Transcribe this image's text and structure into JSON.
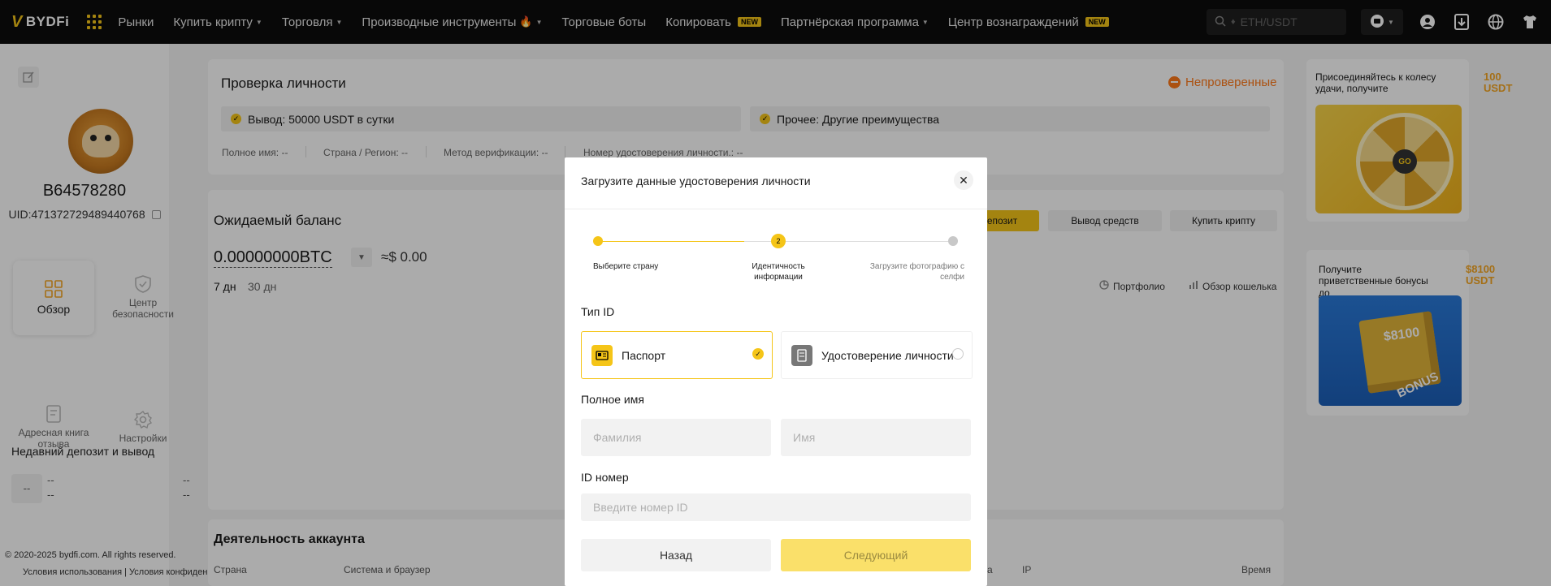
{
  "topnav": {
    "logo": "BYDFi",
    "items": [
      {
        "label": "Рынки",
        "caret": false,
        "badge": "",
        "fire": false
      },
      {
        "label": "Купить крипту",
        "caret": true,
        "badge": "",
        "fire": false
      },
      {
        "label": "Торговля",
        "caret": true,
        "badge": "",
        "fire": false
      },
      {
        "label": "Производные инструменты",
        "caret": true,
        "badge": "",
        "fire": true
      },
      {
        "label": "Торговые боты",
        "caret": false,
        "badge": "",
        "fire": false
      },
      {
        "label": "Копировать",
        "caret": false,
        "badge": "NEW",
        "fire": false
      },
      {
        "label": "Партнёрская программа",
        "caret": true,
        "badge": "",
        "fire": false
      },
      {
        "label": "Центр вознаграждений",
        "caret": false,
        "badge": "NEW",
        "fire": false
      }
    ],
    "search_placeholder": "ETH/USDT",
    "accent": "#f5c518"
  },
  "sidebar": {
    "username": "B64578280",
    "uid": "UID:471372729489440768",
    "tiles": {
      "overview": "Обзор",
      "security": "Центр безопасности",
      "address_book": "Адресная книга отзыва",
      "settings": "Настройки"
    },
    "recent_title": "Недавний депозит и вывод",
    "recent_dash": "--",
    "copyright": "© 2020-2025 bydfi.com. All rights reserved.",
    "footer_links": "Условия использования |  Условия конфиденциальности"
  },
  "kyc": {
    "title": "Проверка личности",
    "status": "Непроверенные",
    "perk1": "Вывод: 50000 USDT в сутки",
    "perk2": "Прочее: Другие преимущества",
    "full_name": "Полное имя: --",
    "country": "Страна / Регион: --",
    "method": "Метод верификации: --",
    "id_no": "Номер удостоверения личности.: --"
  },
  "balance": {
    "title": "Ожидаемый баланс",
    "value": "0.00000000BTC",
    "approx": "≈$ 0.00",
    "range_7d": "7 дн",
    "range_30d": "30 дн",
    "deposit": "Депозит",
    "withdraw": "Вывод средств",
    "buy": "Купить крипту",
    "portfolio": "Портфолио",
    "wallet_overview": "Обзор кошелька"
  },
  "activity": {
    "title": "Деятельность аккаунта",
    "col_country": "Страна",
    "col_browser": "Система и браузер",
    "col_a": "а",
    "col_ip": "IP",
    "col_time": "Время"
  },
  "promo": {
    "wheel_text": "Присоединяйтесь к колесу удачи, получите",
    "wheel_amt": "100 USDT",
    "wheel_go": "GO",
    "bonus_text": "Получите приветственные бонусы до",
    "bonus_amt": "$8100 USDT",
    "bonus_img_amt": "$8100",
    "bonus_img_label": "BONUS"
  },
  "modal": {
    "title": "Загрузите данные удостоверения личности",
    "steps": [
      "Выберите страну",
      "Идентичность информации",
      "Загрузите фотографию с селфи"
    ],
    "step2_number": "2",
    "id_type_label": "Тип ID",
    "passport": "Паспорт",
    "id_card": "Удостоверение личности",
    "full_name_label": "Полное имя",
    "last_name_placeholder": "Фамилия",
    "first_name_placeholder": "Имя",
    "id_number_label": "ID номер",
    "id_number_placeholder": "Введите номер ID",
    "back": "Назад",
    "next": "Следующий"
  }
}
